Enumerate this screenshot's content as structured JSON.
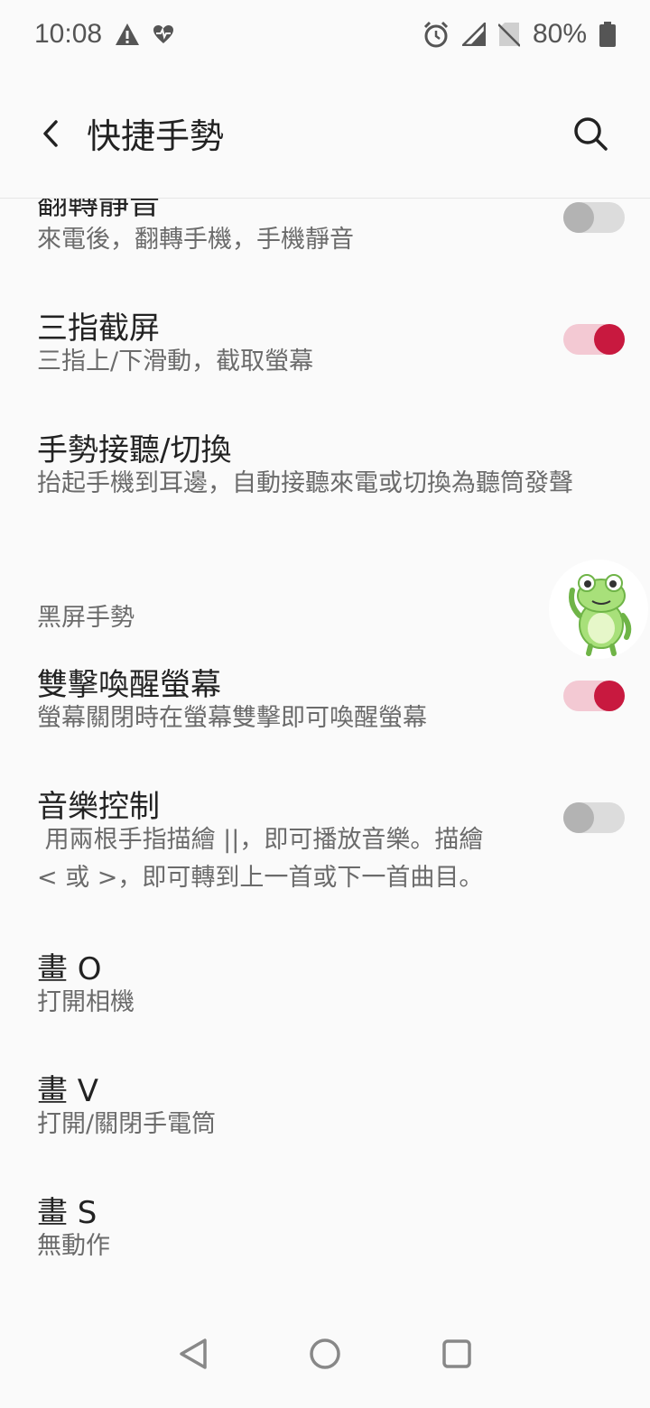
{
  "status": {
    "time": "10:08",
    "battery": "80%",
    "icons": [
      "warning-icon",
      "heart-monitor-icon",
      "alarm-icon",
      "signal-icon",
      "no-sim-icon",
      "battery-icon"
    ]
  },
  "header": {
    "title": "快捷手勢",
    "back_icon": "back-arrow-icon",
    "search_icon": "search-icon"
  },
  "settings": {
    "flip_mute": {
      "title": "翻轉靜音",
      "subtitle": "來電後，翻轉手機，手機靜音",
      "enabled": false
    },
    "three_finger": {
      "title": "三指截屏",
      "subtitle": "三指上/下滑動，截取螢幕",
      "enabled": true
    },
    "gesture_answer": {
      "title": "手勢接聽/切換",
      "subtitle": "抬起手機到耳邊，自動接聽來電或切換為聽筒發聲"
    },
    "section_black_screen": "黑屏手勢",
    "double_tap": {
      "title": "雙擊喚醒螢幕",
      "subtitle": "螢幕關閉時在螢幕雙擊即可喚醒螢幕",
      "enabled": true
    },
    "music_control": {
      "title": "音樂控制",
      "subtitle_line1": " 用兩根手指描繪 ||，即可播放音樂。描繪",
      "subtitle_line2": "< 或 >，即可轉到上一首或下一首曲目。",
      "enabled": false
    },
    "draw_o": {
      "title": "畫 O",
      "subtitle": "打開相機"
    },
    "draw_v": {
      "title": "畫 V",
      "subtitle": "打開/關閉手電筒"
    },
    "draw_s": {
      "title": "畫 S",
      "subtitle": "無動作"
    }
  },
  "colors": {
    "accent": "#c8193f",
    "accent_track": "#f3c9d3",
    "off_thumb": "#b3b3b3",
    "off_track": "#dcdcdc"
  },
  "nav": {
    "icons": [
      "back-triangle-icon",
      "home-circle-icon",
      "recents-square-icon"
    ]
  }
}
